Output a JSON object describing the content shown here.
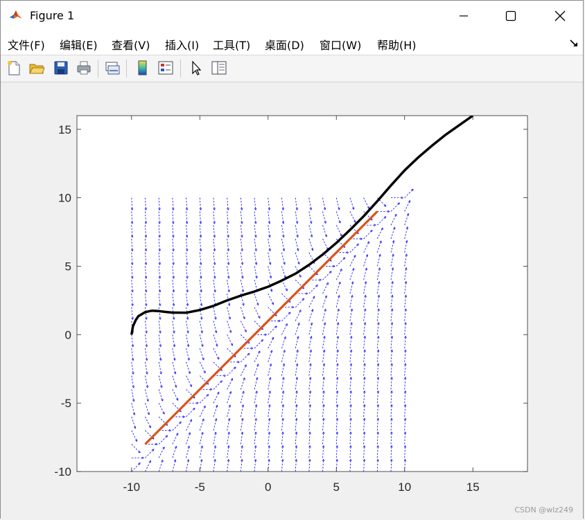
{
  "window": {
    "title": "Figure 1",
    "icon": "matlab-icon",
    "controls": [
      "minimize-icon",
      "maximize-icon",
      "close-icon"
    ]
  },
  "menu": {
    "items": [
      "文件(F)",
      "编辑(E)",
      "查看(V)",
      "插入(I)",
      "工具(T)",
      "桌面(D)",
      "窗口(W)",
      "帮助(H)"
    ],
    "corner_icon": "dock-arrow-icon"
  },
  "toolbar": {
    "buttons": [
      "new-figure-icon",
      "open-file-icon",
      "save-icon",
      "print-icon",
      "link-plot-icon",
      "colorbar-icon",
      "legend-icon",
      "select-pointer-icon",
      "property-inspector-icon"
    ]
  },
  "colors": {
    "quiver": "#0000ff",
    "trajectory": "#000000",
    "line": "#d95319"
  },
  "chart_data": {
    "type": "quiver",
    "xlim": [
      -14,
      19
    ],
    "ylim": [
      -10,
      16
    ],
    "xticks": [
      -10,
      -5,
      0,
      5,
      10,
      15
    ],
    "yticks": [
      -10,
      -5,
      0,
      5,
      10,
      15
    ],
    "xtick_labels": [
      "-10",
      "-5",
      "0",
      "5",
      "10",
      "15"
    ],
    "ytick_labels": [
      "-10",
      "-5",
      "0",
      "5",
      "10",
      "15"
    ],
    "grid": false,
    "vector_field": {
      "x_range": [
        -10,
        10
      ],
      "y_range": [
        -10,
        10
      ],
      "step": 1,
      "dx": "1",
      "dy": "x - y + 1"
    },
    "series": [
      {
        "type": "line",
        "x": [
          -10,
          -9.9,
          -9.7,
          -9.5,
          -9.0,
          -8.5,
          -8.0,
          -7.5,
          -7.0,
          -6.0,
          -5.0,
          -4.0,
          -3.0,
          -2.0,
          -1.0,
          0.0,
          1.0,
          2.0,
          3.0,
          4.0,
          5.0,
          6.0,
          7.0,
          8.0,
          9.0,
          10.0,
          11.0,
          12.0,
          13.0,
          14.0,
          15.0
        ],
        "y": [
          0,
          0.6,
          1.05,
          1.35,
          1.65,
          1.75,
          1.72,
          1.66,
          1.61,
          1.6,
          1.8,
          2.1,
          2.5,
          2.85,
          3.15,
          3.5,
          3.95,
          4.45,
          5.1,
          5.85,
          6.7,
          7.65,
          8.65,
          9.75,
          10.9,
          12.0,
          12.95,
          13.8,
          14.6,
          15.3,
          16.0
        ]
      },
      {
        "type": "line",
        "x": [
          -9,
          8
        ],
        "y": [
          -8,
          9
        ]
      }
    ]
  },
  "watermark": "CSDN @wlz249"
}
